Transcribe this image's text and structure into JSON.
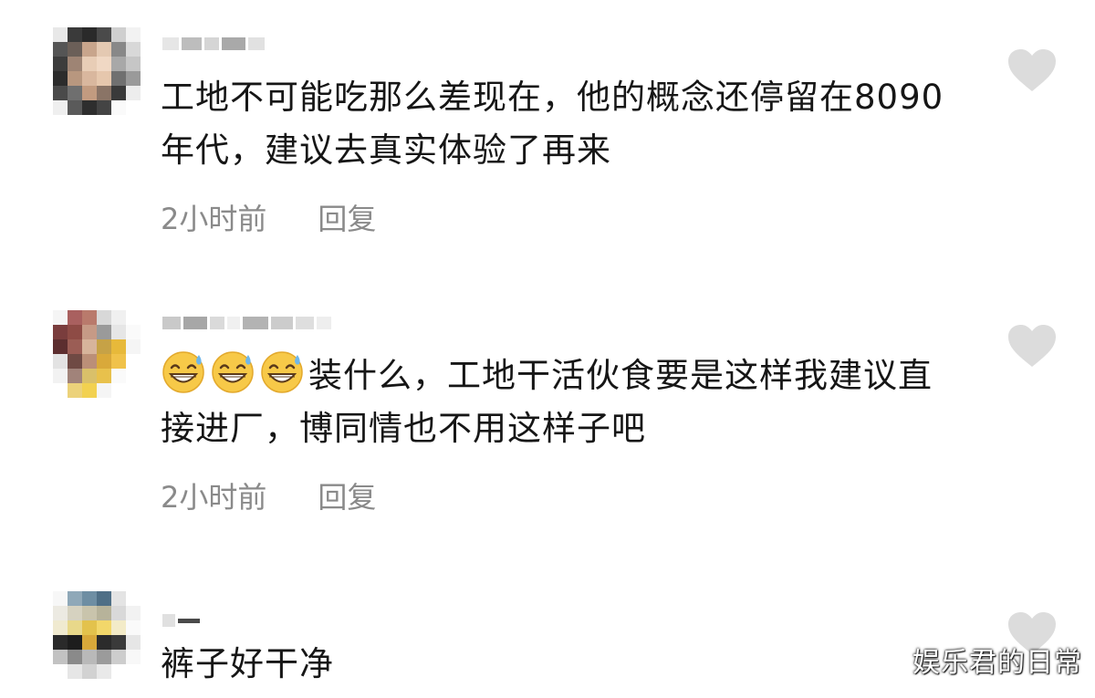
{
  "comments": [
    {
      "avatar_icon": "blurred-avatar",
      "text": "工地不可能吃那么差现在，他的概念还停留在8090年代，建议去真实体验了再来",
      "time": "2小时前",
      "reply_label": "回复",
      "like_icon": "heart-icon"
    },
    {
      "avatar_icon": "blurred-avatar",
      "emoji_icon": "grinning-sweat-emoji",
      "text": "装什么，工地干活伙食要是这样我建议直接进厂，博同情也不用这样子吧",
      "time": "2小时前",
      "reply_label": "回复",
      "like_icon": "heart-icon"
    },
    {
      "avatar_icon": "blurred-avatar",
      "text": "裤子好干净",
      "like_icon": "heart-icon"
    }
  ],
  "watermark": "娱乐君的日常",
  "colors": {
    "text": "#161616",
    "meta": "#8a8a8a",
    "heart": "#dcdcdc"
  }
}
